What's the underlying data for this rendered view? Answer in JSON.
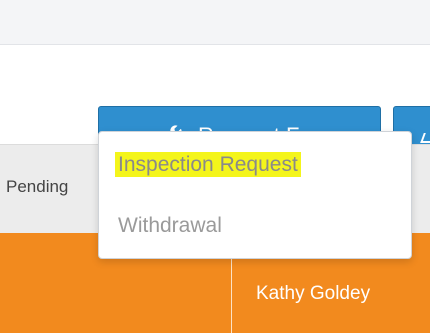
{
  "table": {
    "column_pending": "Pending",
    "row_cell_name": "Kathy Goldey"
  },
  "toolbar": {
    "request_button_label": "Request For"
  },
  "dropdown": {
    "items": [
      {
        "label": "Inspection Request",
        "highlighted": true
      },
      {
        "label": "Withdrawal",
        "highlighted": false
      }
    ]
  },
  "icons": {
    "request_button": "wrench-icon"
  },
  "colors": {
    "button": "#2f8fcf",
    "row_accent": "#f28a1e",
    "highlight": "#f4f51b"
  }
}
